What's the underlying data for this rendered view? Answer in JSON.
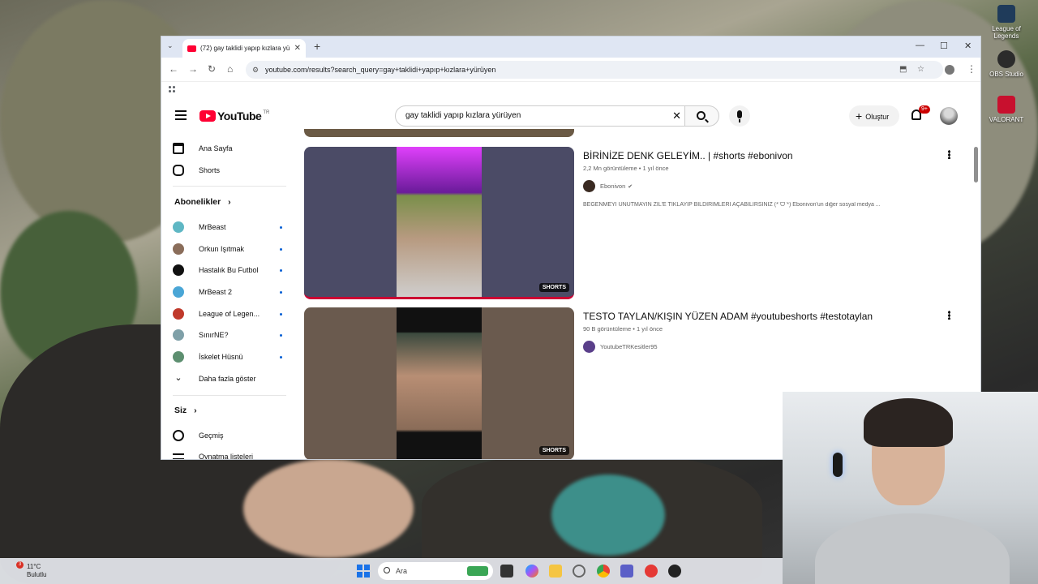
{
  "desktop": {
    "icons": [
      {
        "label": "League of Legends",
        "color": "#1f3b5a"
      },
      {
        "label": "OBS Studio",
        "color": "#2b2b2b"
      },
      {
        "label": "VALORANT",
        "color": "#c8102e"
      }
    ]
  },
  "browser": {
    "tab": {
      "title": "(72) gay taklidi yapıp kızlara yü"
    },
    "url": "youtube.com/results?search_query=gay+taklidi+yapıp+kızlara+yürüyen"
  },
  "youtube": {
    "logo_text": "YouTube",
    "region": "TR",
    "search_query": "gay taklidi yapıp kızlara yürüyen",
    "create_label": "Oluştur",
    "notifications_badge": "9+",
    "sidebar": {
      "main": [
        {
          "label": "Ana Sayfa",
          "icon": "home-icon"
        },
        {
          "label": "Shorts",
          "icon": "shorts-icon"
        }
      ],
      "subscriptions_heading": "Abonelikler",
      "subscriptions": [
        {
          "label": "MrBeast",
          "color": "#5fb7c4"
        },
        {
          "label": "Orkun Işıtmak",
          "color": "#8a6d5a"
        },
        {
          "label": "Hastalık Bu Futbol",
          "color": "#111111"
        },
        {
          "label": "MrBeast 2",
          "color": "#4aa6d6"
        },
        {
          "label": "League of Legen...",
          "color": "#c0392b"
        },
        {
          "label": "SınırNE?",
          "color": "#7fa0a8"
        },
        {
          "label": "İskelet Hüsnü",
          "color": "#5d8f70"
        }
      ],
      "show_more": "Daha fazla göster",
      "you_heading": "Siz",
      "you_items": [
        {
          "label": "Geçmiş",
          "icon": "history-icon"
        },
        {
          "label": "Oynatma listeleri",
          "icon": "playlist-icon"
        }
      ]
    },
    "results": [
      {
        "title": "BİRİNİZE DENK GELEYİM.. | #shorts #ebonivon",
        "meta": "2,2 Mn görüntüleme • 1 yıl önce",
        "channel": "Ebonivon",
        "verified": true,
        "description": "BEĞENMEYİ UNUTMAYIN ZİL'E TIKLAYIP BİLDİRİMLERİ AÇABİLİRSİNİZ (*ˊᗜˋ*) Ebonivon'un diğer sosyal medya ...",
        "badge": "SHORTS"
      },
      {
        "title": "TESTO TAYLAN/KIŞIN YÜZEN ADAM #youtubeshorts #testotaylan",
        "meta": "90 B görüntüleme • 1 yıl önce",
        "channel": "YoutubeTRKesitler95",
        "verified": false,
        "description": "",
        "badge": "SHORTS"
      }
    ]
  },
  "taskbar": {
    "weather_temp": "11°C",
    "weather_desc": "Bulutlu",
    "weather_badge": "3",
    "search_label": "Ara"
  }
}
